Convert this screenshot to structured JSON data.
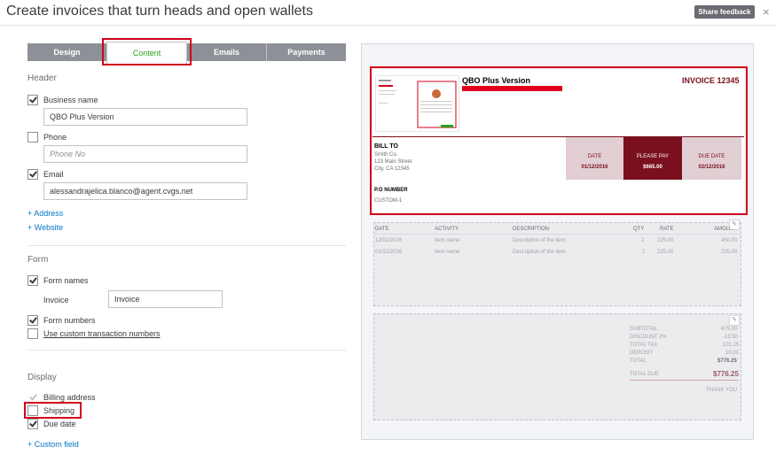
{
  "title": "Create invoices that turn heads and open wallets",
  "share_feedback": "Share feedback",
  "close": "×",
  "tabs": [
    "Design",
    "Content",
    "Emails",
    "Payments"
  ],
  "header": {
    "label": "Header",
    "business_name_label": "Business name",
    "business_name_value": "QBO Plus Version",
    "phone_label": "Phone",
    "phone_placeholder": "Phone No",
    "email_label": "Email",
    "email_value": "alessandrajelica.blanco@agent.cvgs.net",
    "add_address": "+ Address",
    "add_website": "+ Website"
  },
  "form": {
    "label": "Form",
    "form_names_label": "Form names",
    "invoice_label": "Invoice",
    "invoice_value": "Invoice",
    "form_numbers_label": "Form numbers",
    "custom_numbers_label": "Use custom transaction numbers"
  },
  "display": {
    "label": "Display",
    "billing_address": "Billing address",
    "shipping": "Shipping",
    "due_date": "Due date",
    "custom_field": "+ Custom field"
  },
  "invoice": {
    "business_name": "QBO Plus Version",
    "invoice_number": "INVOICE 12345",
    "bill_to_label": "BILL TO",
    "bill_to_lines": [
      "Smith Co.",
      "123 Main Street",
      "City, CA 12345"
    ],
    "date_label": "DATE",
    "date_value": "01/12/2016",
    "please_pay_label": "PLEASE PAY",
    "please_pay_value": "$665.00",
    "due_date_label": "DUE DATE",
    "due_date_value": "02/12/2016",
    "po_label": "P.O NUMBER",
    "po_value": "CUSTOM-1",
    "accent_color": "#7a0f1d",
    "table_headers": [
      "DATE",
      "ACTIVITY",
      "DESCRIPTION",
      "QTY",
      "RATE",
      "AMOU..."
    ],
    "rows": [
      [
        "12/01/2016",
        "Item name",
        "Description of the item",
        "2",
        "225.00",
        "450.00"
      ],
      [
        "01/12/2016",
        "Item name",
        "Description of the item",
        "1",
        "225.00",
        "225.00"
      ]
    ],
    "totals": [
      {
        "label": "SUBTOTAL",
        "value": "675.00"
      },
      {
        "label": "DISCOUNT 2%",
        "value": "-13.50"
      },
      {
        "label": "TOTAL TAX",
        "value": "101.25"
      },
      {
        "label": "DEPOSIT",
        "value": "10.00"
      },
      {
        "label": "TOTAL",
        "value": "$776.25"
      }
    ],
    "total_due_label": "TOTAL DUE",
    "total_due_value": "$776.25",
    "thank_you": "THANK YOU"
  }
}
